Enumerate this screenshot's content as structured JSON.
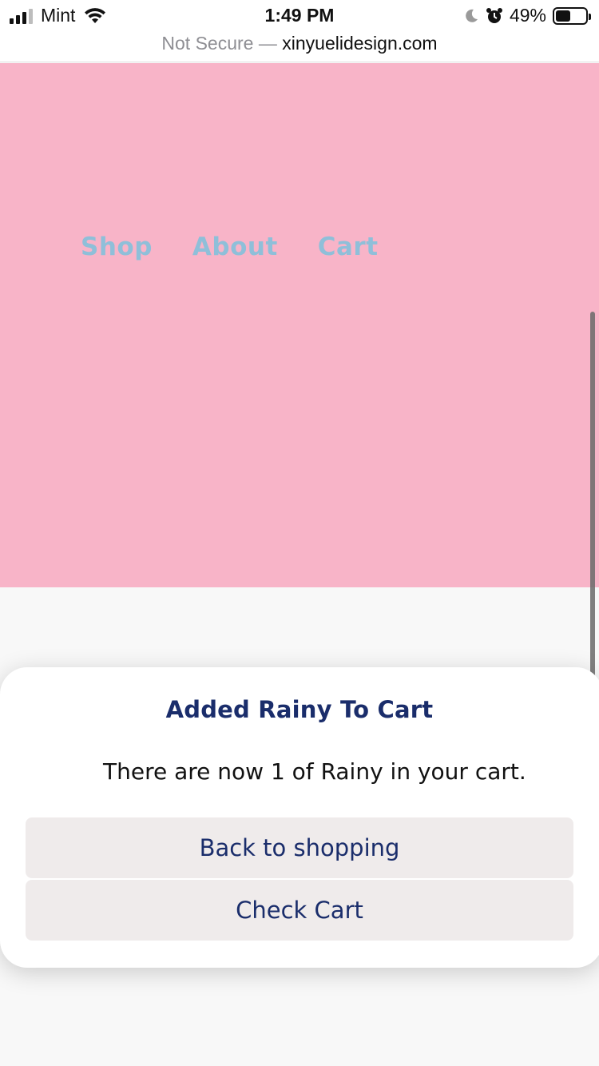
{
  "status_bar": {
    "carrier": "Mint",
    "time": "1:49 PM",
    "battery": "49%",
    "battery_level": 0.49,
    "icons": [
      "signal-icon",
      "wifi-icon",
      "moon-icon",
      "alarm-icon",
      "battery-icon"
    ]
  },
  "url_bar": {
    "security_label": "Not Secure —",
    "domain": "xinyuelidesign.com"
  },
  "nav": {
    "items": [
      {
        "label": "Shop"
      },
      {
        "label": "About"
      },
      {
        "label": "Cart"
      }
    ]
  },
  "modal": {
    "title": "Added Rainy To Cart",
    "message": "There are now 1 of Rainy in your cart.",
    "back_label": "Back to shopping",
    "check_label": "Check Cart"
  },
  "colors": {
    "hero_bg": "#f8b4c8",
    "nav_link": "#8fbfd9",
    "modal_text": "#1a2d6b",
    "button_bg": "#efebeb"
  }
}
